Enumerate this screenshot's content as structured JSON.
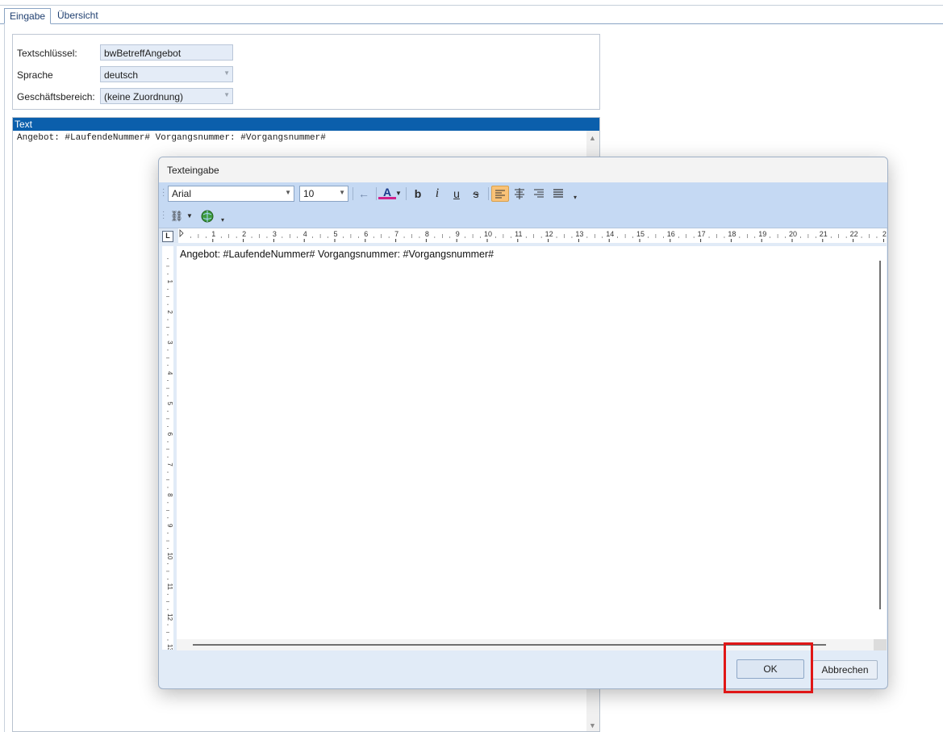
{
  "tabs": [
    {
      "label": "Eingabe",
      "active": true
    },
    {
      "label": "Übersicht",
      "active": false
    }
  ],
  "form": {
    "textschluessel": {
      "label": "Textschlüssel:",
      "value": "bwBetreffAngebot"
    },
    "sprache": {
      "label": "Sprache",
      "value": "deutsch"
    },
    "geschaeftsbereich": {
      "label": "Geschäftsbereich:",
      "value": "(keine Zuordnung)"
    }
  },
  "text_panel": {
    "header": "Text",
    "content": "Angebot: #LaufendeNummer# Vorgangsnummer: #Vorgangsnummer#"
  },
  "dialog": {
    "title": "Texteingabe",
    "toolbar": {
      "font": "Arial",
      "size": "10",
      "bold": "b",
      "italic": "i",
      "underline": "u",
      "strike": "s",
      "font_color_glyph": "A",
      "align_left_active": true
    },
    "ruler_corner": "L",
    "ruler_h_labels": [
      "1",
      "2",
      "3",
      "4",
      "5",
      "6",
      "7",
      "8",
      "9",
      "10",
      "11",
      "12",
      "13",
      "14",
      "15",
      "16",
      "17",
      "18",
      "19",
      "20",
      "21",
      "22",
      "2"
    ],
    "ruler_v_labels": [
      "1",
      "2",
      "3",
      "4",
      "5",
      "6",
      "7",
      "8",
      "9",
      "10",
      "11",
      "12",
      "13"
    ],
    "editor_text": "Angebot: #LaufendeNummer# Vorgangsnummer: #Vorgangsnummer#",
    "ok_label": "OK",
    "cancel_label": "Abbrechen"
  },
  "colors": {
    "header_blue": "#0b5fac",
    "toolbar_blue": "#c5d9f3",
    "dialog_bg": "#e1ebf7",
    "active_button": "#f9c277",
    "highlight_red": "#e01616"
  },
  "icons": [
    "undo-arrow-icon",
    "font-color-icon",
    "bold-icon",
    "italic-icon",
    "underline-icon",
    "strikethrough-icon",
    "align-left-icon",
    "align-center-icon",
    "align-right-icon",
    "justify-icon",
    "link-icon",
    "globe-icon"
  ]
}
